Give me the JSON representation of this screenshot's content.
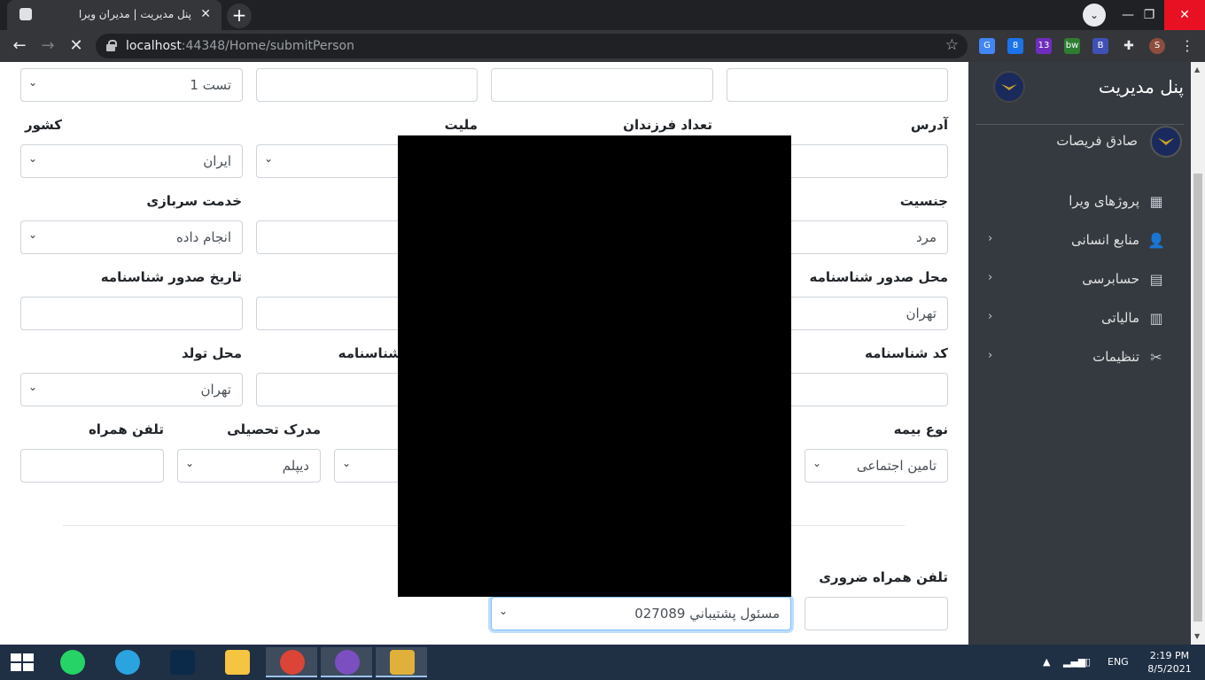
{
  "browser": {
    "tab_title": "پنل مدیریت | مدیران ویرا",
    "tab_close": "✕",
    "new_tab": "+",
    "url_host": "localhost",
    "url_rest": ":44348/Home/submitPerson",
    "window_controls": {
      "minimize": "—",
      "maximize": "❐",
      "close": "✕"
    },
    "extensions": [
      {
        "icon": "google-translate-icon",
        "text": "G",
        "color": "#4285f4"
      },
      {
        "icon": "extension-8-icon",
        "text": "8",
        "color": "#1a73e8"
      },
      {
        "icon": "extension-badge-icon",
        "text": "13",
        "color": "#6f2dbd"
      },
      {
        "icon": "bw-icon",
        "text": "bw",
        "color": "#2e7d32"
      },
      {
        "icon": "b-icon",
        "text": "B",
        "color": "#3f51b5"
      }
    ],
    "profile_initial": "S"
  },
  "sidebar": {
    "brand": "پنل مدیریت",
    "user_name": "صادق فریصات",
    "items": [
      {
        "label": "پروژهای ویرا",
        "icon": "grid-icon",
        "glyph": "▦",
        "has_arrow": false
      },
      {
        "label": "منابع انسانی",
        "icon": "user-plus-icon",
        "glyph": "👤",
        "has_arrow": true
      },
      {
        "label": "حسابرسی",
        "icon": "calculator-icon",
        "glyph": "▤",
        "has_arrow": true
      },
      {
        "label": "مالیاتی",
        "icon": "bar-chart-icon",
        "glyph": "▥",
        "has_arrow": true
      },
      {
        "label": "تنظیمات",
        "icon": "tools-icon",
        "glyph": "✂",
        "has_arrow": true
      }
    ],
    "arrow": "‹"
  },
  "form": {
    "row1": {
      "select_value": "تست 1"
    },
    "labels": {
      "address": "آدرس",
      "children": "تعداد فرزندان",
      "nationality": "ملیت",
      "country": "کشور",
      "gender": "جنسیت",
      "military": "خدمت سربازی",
      "issue_place": "محل صدور شناسنامه",
      "issue_date": "تاریخ صدور شناسنامه",
      "id_code": "کد شناسنامه",
      "id_number_partial": "شناسنامه",
      "birth_place": "محل تولد",
      "insurance": "نوع بیمه",
      "education": "مدرک تحصیلی",
      "mobile": "تلفن همراه",
      "emergency_mobile": "تلفن همراه ضروری"
    },
    "values": {
      "country": "ایران",
      "gender": "مرد",
      "military": "انجام داده",
      "issue_place": "تهران",
      "birth_place": "تهران",
      "insurance": "تامین اجتماعی",
      "education": "دیپلم",
      "support": "مسئول پشتيباني 027089"
    }
  },
  "taskbar": {
    "apps": [
      {
        "name": "whatsapp-icon",
        "color": "#25d366"
      },
      {
        "name": "telegram-icon",
        "color": "#2aa3df"
      },
      {
        "name": "photoshop-icon",
        "color": "#0b2a4a"
      },
      {
        "name": "file-explorer-icon",
        "color": "#f5c542"
      },
      {
        "name": "chrome-icon",
        "color": "#db4437"
      },
      {
        "name": "visual-studio-icon",
        "color": "#7b4fbf"
      },
      {
        "name": "app-icon",
        "color": "#e0b13a"
      }
    ],
    "lang": "ENG",
    "time": "2:19 PM",
    "date": "8/5/2021"
  }
}
